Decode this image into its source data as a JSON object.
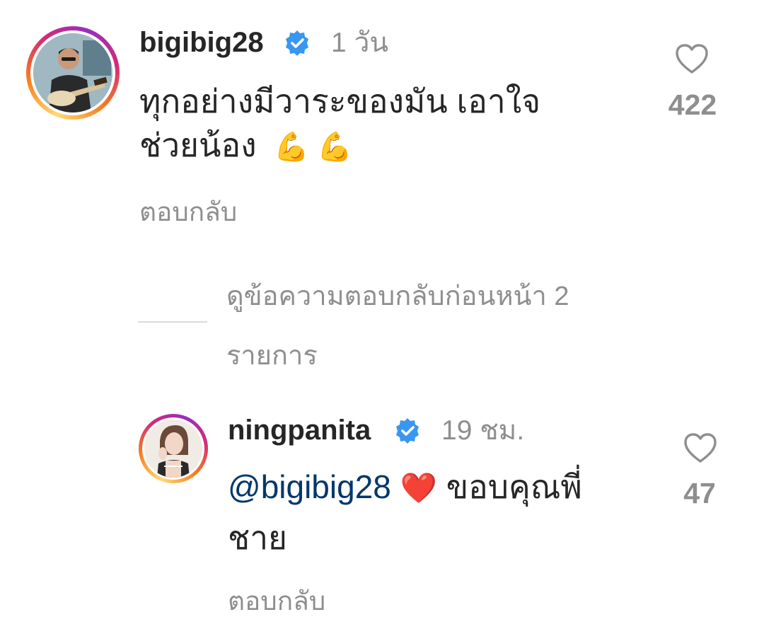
{
  "comments": [
    {
      "username": "bigibig28",
      "verified": true,
      "time": "1 วัน",
      "text_line1": "ทุกอย่างมีวาระของมัน เอาใจ",
      "text_line2": "ช่วยน้อง",
      "emoji": "💪 💪",
      "likes": "422",
      "reply_label": "ตอบกลับ",
      "avatar_icon": "avatar-guitar-player",
      "heart_icon": "heart-outline-icon"
    }
  ],
  "replies_toggle": {
    "label_line1": "ดูข้อความตอบกลับก่อนหน้า 2",
    "label_line2": "รายการ"
  },
  "replies": [
    {
      "username": "ningpanita",
      "verified": true,
      "time": "19 ชม.",
      "mention": "@bigibig28",
      "heart_emoji": "❤️",
      "text_after": "ขอบคุณพี่",
      "text_line2": "ชาย",
      "likes": "47",
      "reply_label": "ตอบกลับ",
      "avatar_icon": "avatar-woman-portrait",
      "heart_icon": "heart-outline-icon"
    }
  ],
  "colors": {
    "text": "#262626",
    "secondary": "#8e8e8e",
    "mention": "#00376b",
    "verified": "#3897f0",
    "divider": "#dbdbdb"
  }
}
